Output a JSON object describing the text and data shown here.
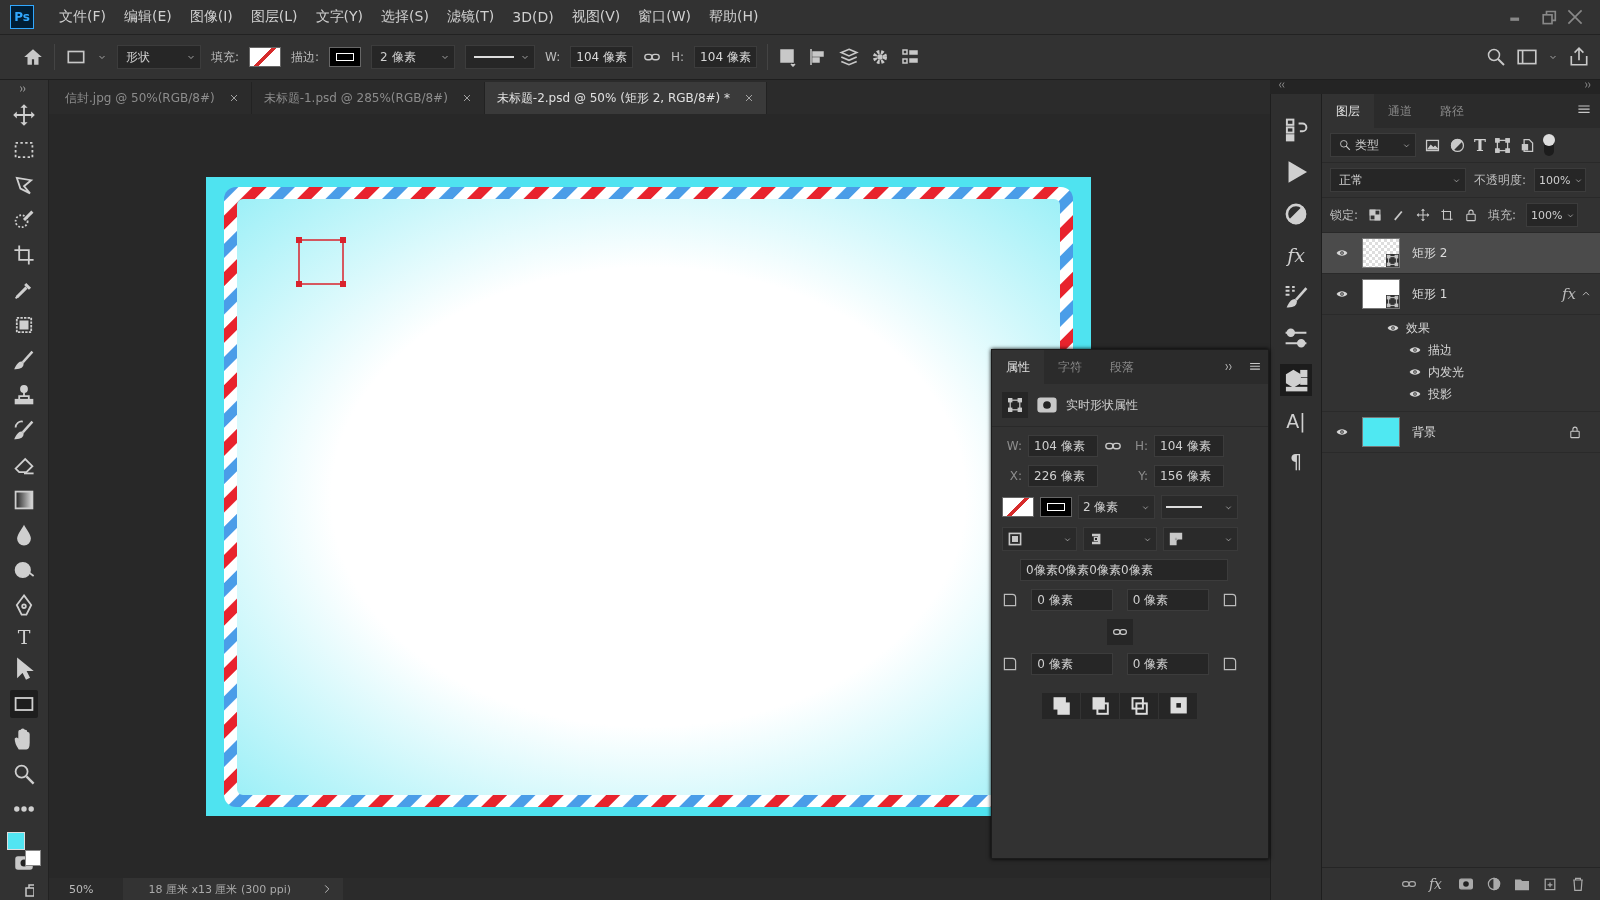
{
  "app": {
    "logo": "Ps"
  },
  "menu": [
    "文件(F)",
    "编辑(E)",
    "图像(I)",
    "图层(L)",
    "文字(Y)",
    "选择(S)",
    "滤镜(T)",
    "3D(D)",
    "视图(V)",
    "窗口(W)",
    "帮助(H)"
  ],
  "options_bar": {
    "tool_mode": "形状",
    "fill_label": "填充:",
    "stroke_label": "描边:",
    "stroke_width": "2 像素",
    "w_label": "W:",
    "w_value": "104 像素",
    "h_label": "H:",
    "h_value": "104 像素"
  },
  "document_tabs": [
    {
      "title": "信封.jpg @ 50%(RGB/8#)",
      "selected": false
    },
    {
      "title": "未标题-1.psd @ 285%(RGB/8#)",
      "selected": false
    },
    {
      "title": "未标题-2.psd @ 50% (矩形 2, RGB/8#) *",
      "selected": true
    }
  ],
  "tools": [
    {
      "kind": "move",
      "selected": false
    },
    {
      "kind": "marquee",
      "selected": false
    },
    {
      "kind": "lasso",
      "selected": false
    },
    {
      "kind": "quickselect",
      "selected": false
    },
    {
      "kind": "crop",
      "selected": false
    },
    {
      "kind": "eyedropper",
      "selected": false
    },
    {
      "kind": "frame",
      "selected": false
    },
    {
      "kind": "brush",
      "selected": false
    },
    {
      "kind": "stamp",
      "selected": false
    },
    {
      "kind": "historybrush",
      "selected": false
    },
    {
      "kind": "eraser",
      "selected": false
    },
    {
      "kind": "gradient",
      "selected": false
    },
    {
      "kind": "blur",
      "selected": false
    },
    {
      "kind": "dodge",
      "selected": false
    },
    {
      "kind": "pen",
      "selected": false
    },
    {
      "kind": "glyph",
      "glyph": "T",
      "selected": false
    },
    {
      "kind": "pathselect",
      "selected": false
    },
    {
      "kind": "rectangle",
      "selected": true
    },
    {
      "kind": "hand",
      "selected": false
    },
    {
      "kind": "zoom",
      "selected": false
    },
    {
      "kind": "more",
      "selected": false
    }
  ],
  "swatches": [
    {
      "kind": "foreground",
      "color": "#52e5f2"
    },
    {
      "kind": "background",
      "color": "#ffffff"
    }
  ],
  "status_bar": {
    "zoom": "50%",
    "document_info": "18 厘米 x13 厘米 (300 ppi)"
  },
  "properties_panel": {
    "tabs": [
      {
        "label": "属性",
        "selected": true
      },
      {
        "label": "字符",
        "selected": false
      },
      {
        "label": "段落",
        "selected": false
      }
    ],
    "title": "实时形状属性",
    "w_label": "W:",
    "w_value": "104 像素",
    "h_label": "H:",
    "h_value": "104 像素",
    "x_label": "X:",
    "x_value": "226 像素",
    "y_label": "Y:",
    "y_value": "156 像素",
    "stroke_width": "2 像素",
    "corner_summary": "0像素0像素0像素0像素",
    "corners": [
      "0 像素",
      "0 像素",
      "0 像素",
      "0 像素"
    ]
  },
  "dock_icons": [
    {
      "kind": "history",
      "selected": false
    },
    {
      "kind": "play",
      "selected": false
    },
    {
      "kind": "color",
      "selected": false
    },
    {
      "kind": "glyph",
      "glyph": "fx",
      "selected": false
    },
    {
      "kind": "brushes",
      "selected": false
    },
    {
      "kind": "sliders",
      "selected": false
    },
    {
      "kind": "cube",
      "selected": true
    },
    {
      "kind": "glyph",
      "glyph": "A|",
      "selected": false
    },
    {
      "kind": "glyph",
      "glyph": "¶",
      "selected": false
    }
  ],
  "layers_panel": {
    "tabs": [
      {
        "label": "图层",
        "selected": true
      },
      {
        "label": "通道",
        "selected": false
      },
      {
        "label": "路径",
        "selected": false
      }
    ],
    "filter": "类型",
    "filter_type_glyph": "T",
    "blend_mode": "正常",
    "opacity_label": "不透明度:",
    "opacity": "100%",
    "lock_label": "锁定:",
    "fill_label": "填充:",
    "fill": "100%",
    "layers": [
      {
        "name": "矩形 2",
        "kind": "shape",
        "filled": false,
        "selected": true,
        "visible": true,
        "locked": false
      },
      {
        "name": "矩形 1",
        "kind": "shape",
        "filled": true,
        "selected": false,
        "visible": true,
        "locked": false,
        "fx": "fx",
        "expanded": true,
        "children": [
          {
            "name": "效果",
            "visible": true,
            "children": [
              {
                "name": "描边",
                "visible": true
              },
              {
                "name": "内发光",
                "visible": true
              },
              {
                "name": "投影",
                "visible": true
              }
            ]
          }
        ]
      },
      {
        "name": "背景",
        "kind": "fill",
        "color": "#4fe8f2",
        "selected": false,
        "visible": true,
        "locked": true
      }
    ],
    "footer_fx": "fx"
  }
}
